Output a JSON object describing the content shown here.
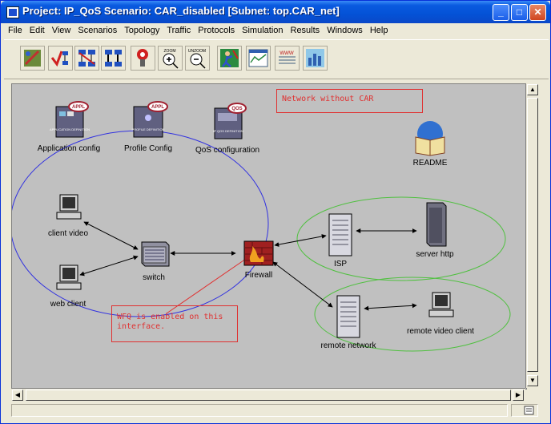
{
  "window": {
    "title": "Project: IP_QoS Scenario: CAR_disabled  [Subnet: top.CAR_net]"
  },
  "menu": [
    "File",
    "Edit",
    "View",
    "Scenarios",
    "Topology",
    "Traffic",
    "Protocols",
    "Simulation",
    "Results",
    "Windows",
    "Help"
  ],
  "toolbar": {
    "icons": [
      "open-scenario-icon",
      "verify-links-icon",
      "fail-node-icon",
      "recover-node-icon",
      "failure-recovery-icon",
      "zoom-icon",
      "unzoom-icon",
      "run-simulation-icon",
      "view-results-icon",
      "web-report-icon",
      "hide-graphs-icon"
    ],
    "zoom_label": "ZOOM",
    "unzoom_label": "UNZOOM",
    "www_label": "www"
  },
  "nodes": {
    "app_config": {
      "label": "Application config",
      "badge": "APPL",
      "caption": "APPLICATION DEFINITION"
    },
    "profile_config": {
      "label": "Profile Config",
      "badge": "APPL",
      "caption": "PROFILE DEFINITION"
    },
    "qos_config": {
      "label": "QoS configuration",
      "badge": "QOS",
      "caption": "IP QOS DEFINITION"
    },
    "readme": {
      "label": "README"
    },
    "client_video": {
      "label": "client video"
    },
    "web_client": {
      "label": "web client"
    },
    "switch": {
      "label": "switch"
    },
    "firewall": {
      "label": "Firewall"
    },
    "isp": {
      "label": "ISP"
    },
    "server_http": {
      "label": "server http"
    },
    "remote_network": {
      "label": "remote network"
    },
    "remote_video_client": {
      "label": "remote video client"
    }
  },
  "annotations": {
    "header": "Network without CAR",
    "wfq_line1": "WFQ is enabled on this",
    "wfq_line2": "interface."
  },
  "colors": {
    "title_bar": "#0452d6",
    "canvas": "#c0c0c0",
    "blue_ellipse": "#3030e0",
    "green_ellipse": "#50c040",
    "annotation": "#e03030"
  }
}
